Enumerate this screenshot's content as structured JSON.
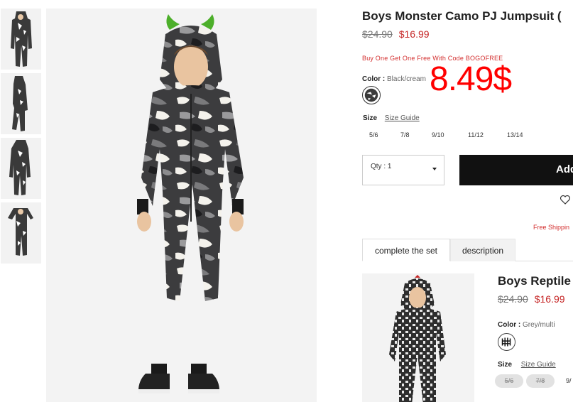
{
  "thumbnails": [
    {
      "alt": "thumbnail-front"
    },
    {
      "alt": "thumbnail-side"
    },
    {
      "alt": "thumbnail-back"
    },
    {
      "alt": "thumbnail-hood-up"
    }
  ],
  "product": {
    "title": "Boys Monster Camo PJ Jumpsuit (",
    "old_price": "$24.90",
    "new_price": "$16.99",
    "promo": "Buy One Get One Free With Code BOGOFREE",
    "color_label": "Color :",
    "color_value": "Black/cream",
    "overlay_price": "8.49$",
    "size_label": "Size",
    "size_guide": "Size Guide",
    "sizes": [
      "5/6",
      "7/8",
      "9/10",
      "11/12",
      "13/14"
    ],
    "qty_label": "Qty : 1",
    "add_button": "Add",
    "shipping_note": "Free Shippin"
  },
  "tabs": [
    {
      "label": "complete the set",
      "active": true
    },
    {
      "label": "description",
      "active": false
    }
  ],
  "related": {
    "title": "Boys Reptile",
    "old_price": "$24.90",
    "new_price": "$16.99",
    "color_label": "Color :",
    "color_value": "Grey/multi",
    "size_label": "Size",
    "size_guide": "Size Guide",
    "sizes_unavailable": [
      "5/6",
      "7/8"
    ],
    "size_partial": "9/"
  },
  "colors": {
    "price_red": "#c62828",
    "overlay_red": "#ff0000",
    "button_black": "#111111"
  }
}
